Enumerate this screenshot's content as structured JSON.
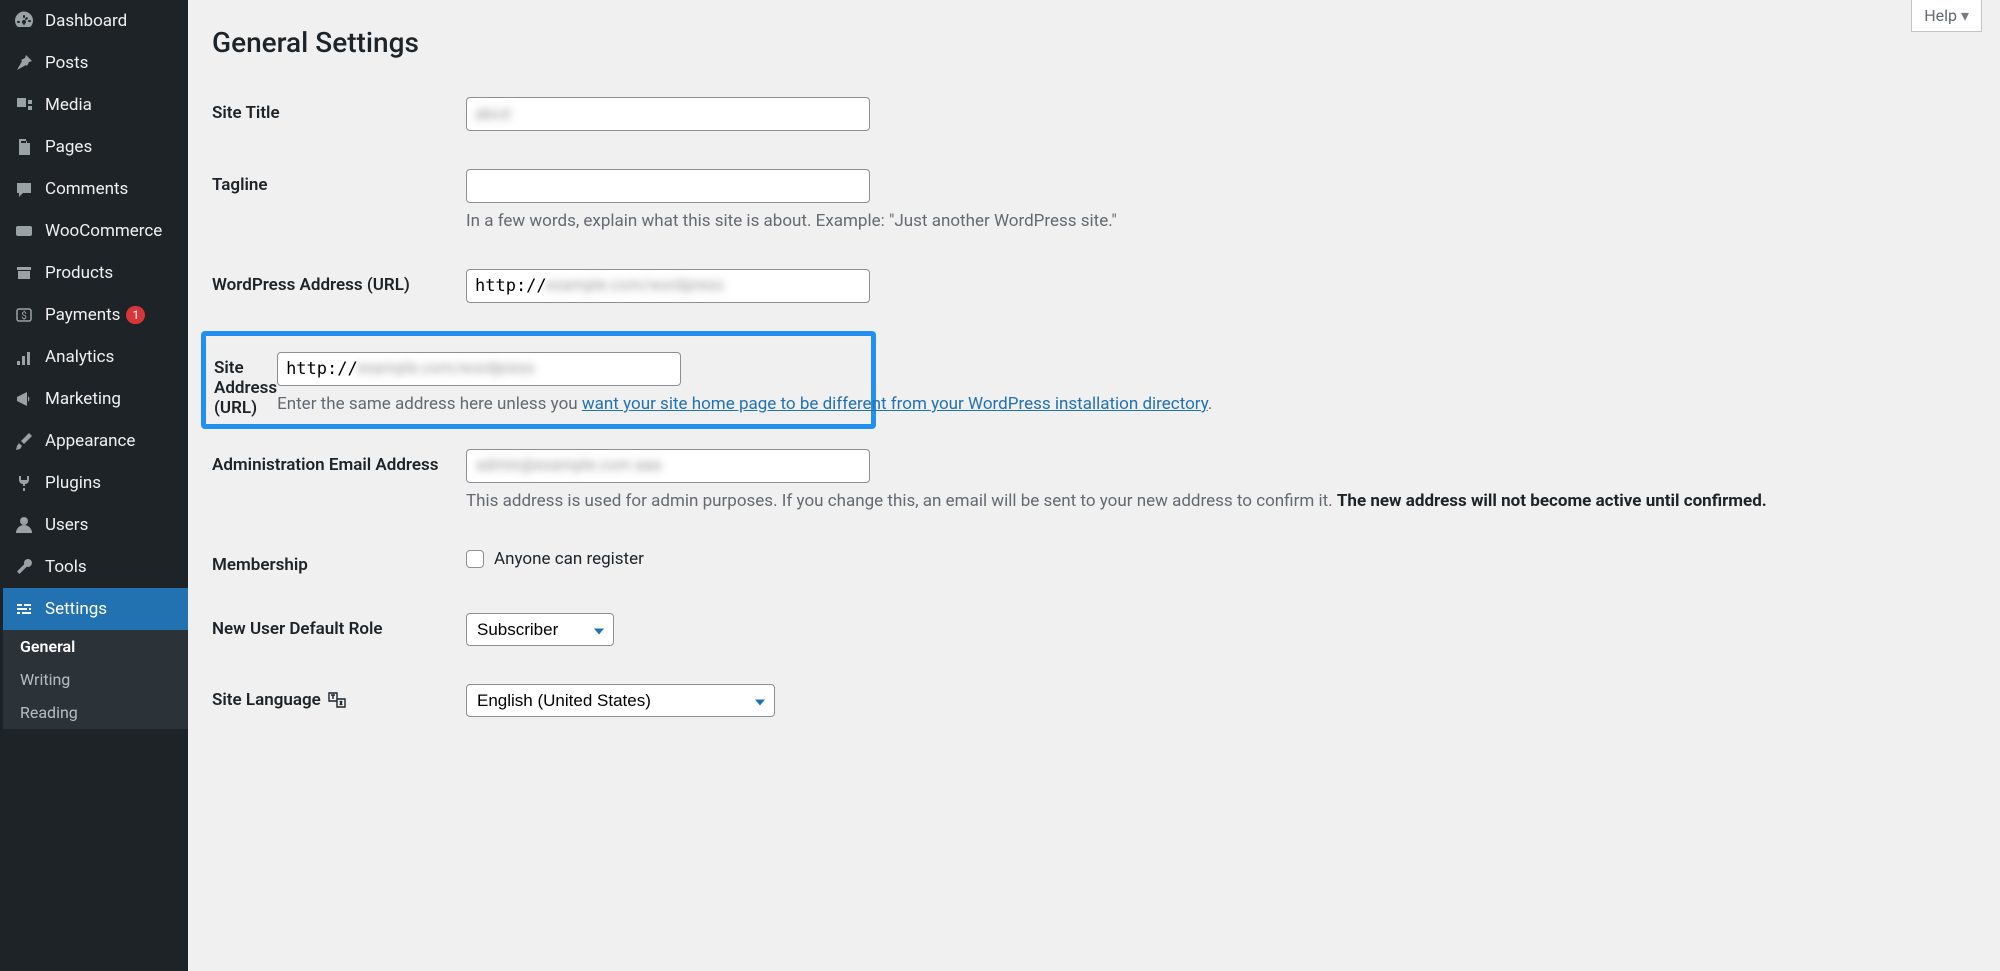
{
  "sidebar": {
    "items": [
      {
        "label": "Dashboard"
      },
      {
        "label": "Posts"
      },
      {
        "label": "Media"
      },
      {
        "label": "Pages"
      },
      {
        "label": "Comments"
      },
      {
        "label": "WooCommerce"
      },
      {
        "label": "Products"
      },
      {
        "label": "Payments",
        "badge": "1"
      },
      {
        "label": "Analytics"
      },
      {
        "label": "Marketing"
      },
      {
        "label": "Appearance"
      },
      {
        "label": "Plugins"
      },
      {
        "label": "Users"
      },
      {
        "label": "Tools"
      },
      {
        "label": "Settings"
      }
    ],
    "sub_items": [
      {
        "label": "General"
      },
      {
        "label": "Writing"
      },
      {
        "label": "Reading"
      }
    ]
  },
  "help": {
    "label": "Help"
  },
  "page": {
    "title": "General Settings"
  },
  "form": {
    "site_title": {
      "label": "Site Title",
      "value": ""
    },
    "tagline": {
      "label": "Tagline",
      "value": "",
      "description": "In a few words, explain what this site is about. Example: \"Just another WordPress site.\""
    },
    "wp_address": {
      "label": "WordPress Address (URL)",
      "value": "http://"
    },
    "site_address": {
      "label": "Site Address (URL)",
      "value": "http://",
      "desc_prefix": "Enter the same address here unless you ",
      "desc_link": "want your site home page to be different from your WordPress installation directory",
      "desc_suffix": "."
    },
    "admin_email": {
      "label": "Administration Email Address",
      "value": "",
      "desc_prefix": "This address is used for admin purposes. If you change this, an email will be sent to your new address to confirm it. ",
      "desc_strong": "The new address will not become active until confirmed."
    },
    "membership": {
      "label": "Membership",
      "checkbox_label": "Anyone can register"
    },
    "default_role": {
      "label": "New User Default Role",
      "value": "Subscriber"
    },
    "site_language": {
      "label": "Site Language",
      "value": "English (United States)"
    }
  }
}
